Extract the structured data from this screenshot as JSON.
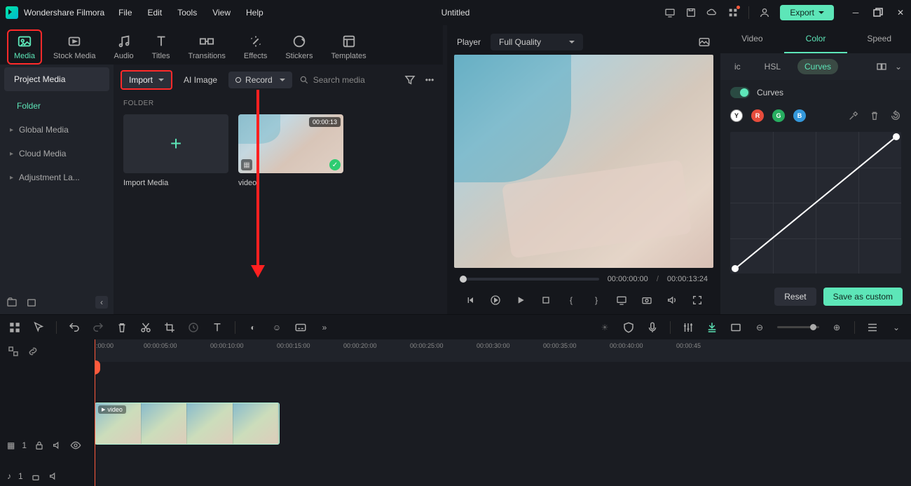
{
  "app_name": "Wondershare Filmora",
  "document_title": "Untitled",
  "menu": [
    "File",
    "Edit",
    "Tools",
    "View",
    "Help"
  ],
  "export_label": "Export",
  "tabs": [
    "Media",
    "Stock Media",
    "Audio",
    "Titles",
    "Transitions",
    "Effects",
    "Stickers",
    "Templates"
  ],
  "sidebar": {
    "project_media": "Project Media",
    "folder": "Folder",
    "items": [
      "Global Media",
      "Cloud Media",
      "Adjustment La..."
    ]
  },
  "toolbar": {
    "import": "Import",
    "ai_image": "AI Image",
    "record": "Record",
    "search_placeholder": "Search media"
  },
  "folder_title": "FOLDER",
  "cards": {
    "import_media": "Import Media",
    "video_label": "video",
    "video_duration": "00:00:13"
  },
  "preview": {
    "player": "Player",
    "quality": "Full Quality",
    "time_current": "00:00:00:00",
    "time_total": "00:00:13:24"
  },
  "panel": {
    "tabs": [
      "Video",
      "Color",
      "Speed"
    ],
    "subtabs": {
      "ic": "ic",
      "hsl": "HSL",
      "curves": "Curves"
    },
    "curves_label": "Curves",
    "channels": {
      "y": "Y",
      "r": "R",
      "g": "G",
      "b": "B"
    },
    "reset": "Reset",
    "save": "Save as custom"
  },
  "timeline": {
    "marks": [
      ":00:00",
      "00:00:05:00",
      "00:00:10:00",
      "00:00:15:00",
      "00:00:20:00",
      "00:00:25:00",
      "00:00:30:00",
      "00:00:35:00",
      "00:00:40:00",
      "00:00:45"
    ],
    "clip_label": "video",
    "track_video": "1",
    "track_audio": "1"
  }
}
